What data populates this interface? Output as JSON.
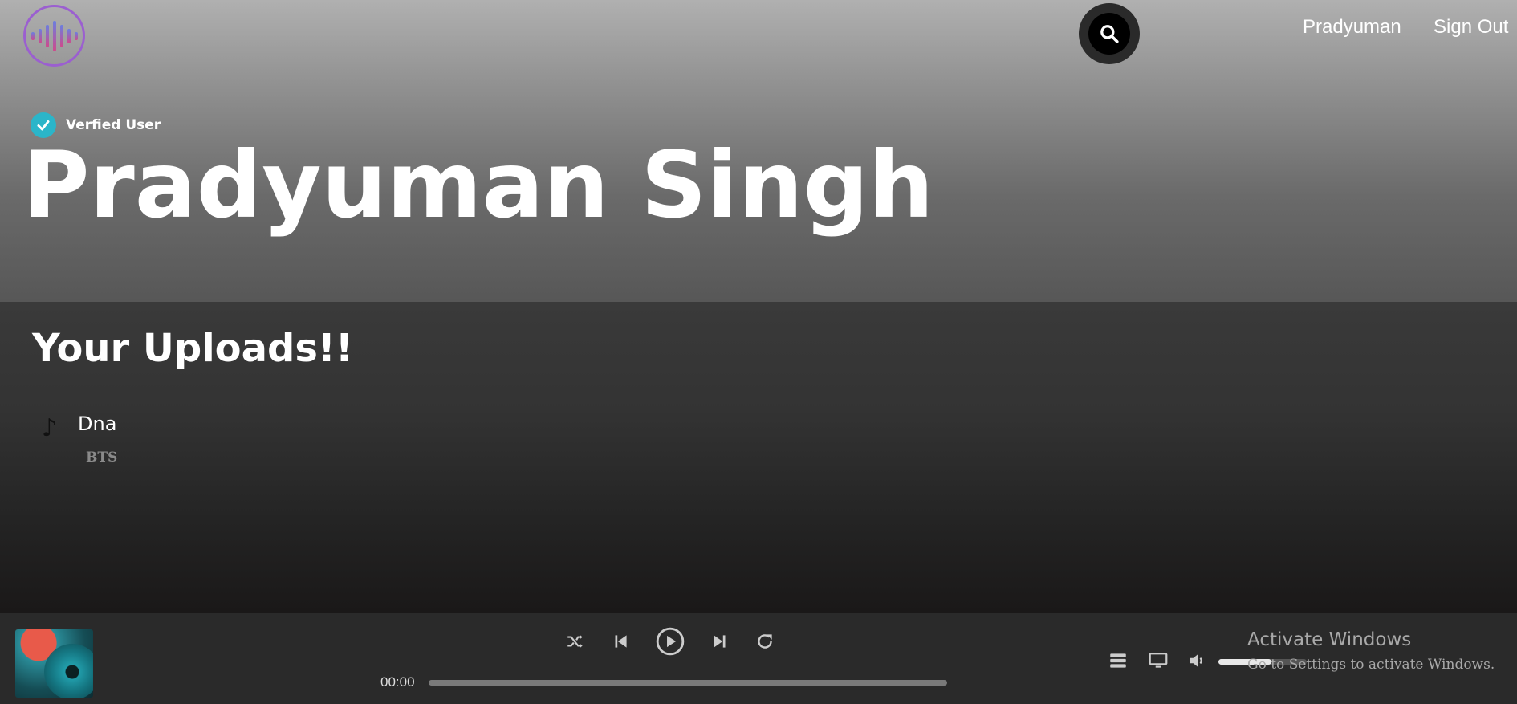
{
  "header": {
    "logo_icon": "soundwave-logo-icon",
    "search_icon": "search-icon",
    "user_link": "Pradyuman",
    "signout_link": "Sign Out"
  },
  "profile": {
    "verified_label": "Verfied User",
    "name": "Pradyuman Singh"
  },
  "uploads": {
    "title": "Your Uploads!!",
    "songs": [
      {
        "icon": "music-note-icon",
        "title": "Dna",
        "artist": "BTS"
      }
    ]
  },
  "player": {
    "current_time": "00:00",
    "progress": 0,
    "volume": 0.6,
    "controls": [
      "shuffle-icon",
      "previous-icon",
      "play-icon",
      "next-icon",
      "repeat-icon"
    ],
    "right_icons": [
      "queue-icon",
      "device-icon",
      "volume-icon"
    ]
  },
  "watermark": {
    "title": "Activate Windows",
    "subtitle": "Go to Settings to activate Windows."
  },
  "colors": {
    "verified_badge": "#2bb5c9",
    "player_bg": "#2a2a2a"
  }
}
